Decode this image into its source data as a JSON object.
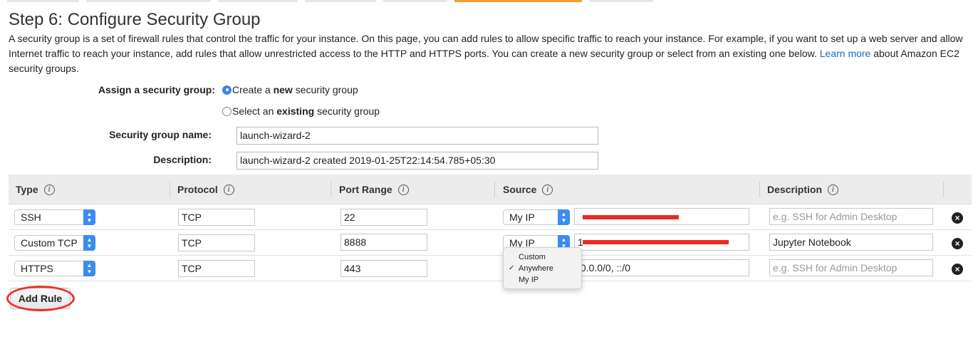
{
  "page": {
    "title": "Step 6: Configure Security Group",
    "intro_text": "A security group is a set of firewall rules that control the traffic for your instance. On this page, you can add rules to allow specific traffic to reach your instance. For example, if you want to set up a web server and allow Internet traffic to reach your instance, add rules that allow unrestricted access to the HTTP and HTTPS ports. You can create a new security group or select from an existing one below.",
    "learn_more": "Learn more",
    "intro_suffix": "about Amazon EC2 security groups."
  },
  "assign": {
    "label": "Assign a security group:",
    "option_new_prefix": "Create a",
    "option_new_bold": "new",
    "option_new_suffix": "security group",
    "option_existing_prefix": "Select an",
    "option_existing_bold": "existing",
    "option_existing_suffix": "security group",
    "selected": "new"
  },
  "form": {
    "name_label": "Security group name:",
    "name_value": "launch-wizard-2",
    "description_label": "Description:",
    "description_value": "launch-wizard-2 created 2019-01-25T22:14:54.785+05:30"
  },
  "table": {
    "headers": {
      "type": "Type",
      "protocol": "Protocol",
      "port_range": "Port Range",
      "source": "Source",
      "description": "Description"
    },
    "info_glyph": "i",
    "rows": [
      {
        "type": "SSH",
        "protocol": "TCP",
        "port": "22",
        "source": "My IP",
        "cidr": "",
        "description": "",
        "description_placeholder": "e.g. SSH for Admin Desktop"
      },
      {
        "type": "Custom TCP",
        "protocol": "TCP",
        "port": "8888",
        "source": "My IP",
        "cidr": "1",
        "description": "Jupyter Notebook",
        "description_placeholder": "e.g. SSH for Admin Desktop"
      },
      {
        "type": "HTTPS",
        "protocol": "TCP",
        "port": "443",
        "source": "Anywhere",
        "cidr": ".0.0.0/0, ::/0",
        "description": "",
        "description_placeholder": "e.g. SSH for Admin Desktop"
      }
    ]
  },
  "source_dropdown": {
    "options": [
      "Custom",
      "Anywhere",
      "My IP"
    ],
    "checked": "Anywhere",
    "check_glyph": "✓"
  },
  "icons": {
    "stepper": "⌃⌄",
    "delete": "×"
  },
  "add_rule_label": "Add Rule",
  "colors": {
    "accent_tab": "#f0a030",
    "link": "#1a6cc2",
    "stepper_blue": "#3b8cf2",
    "annotation_red": "#e8342a"
  }
}
